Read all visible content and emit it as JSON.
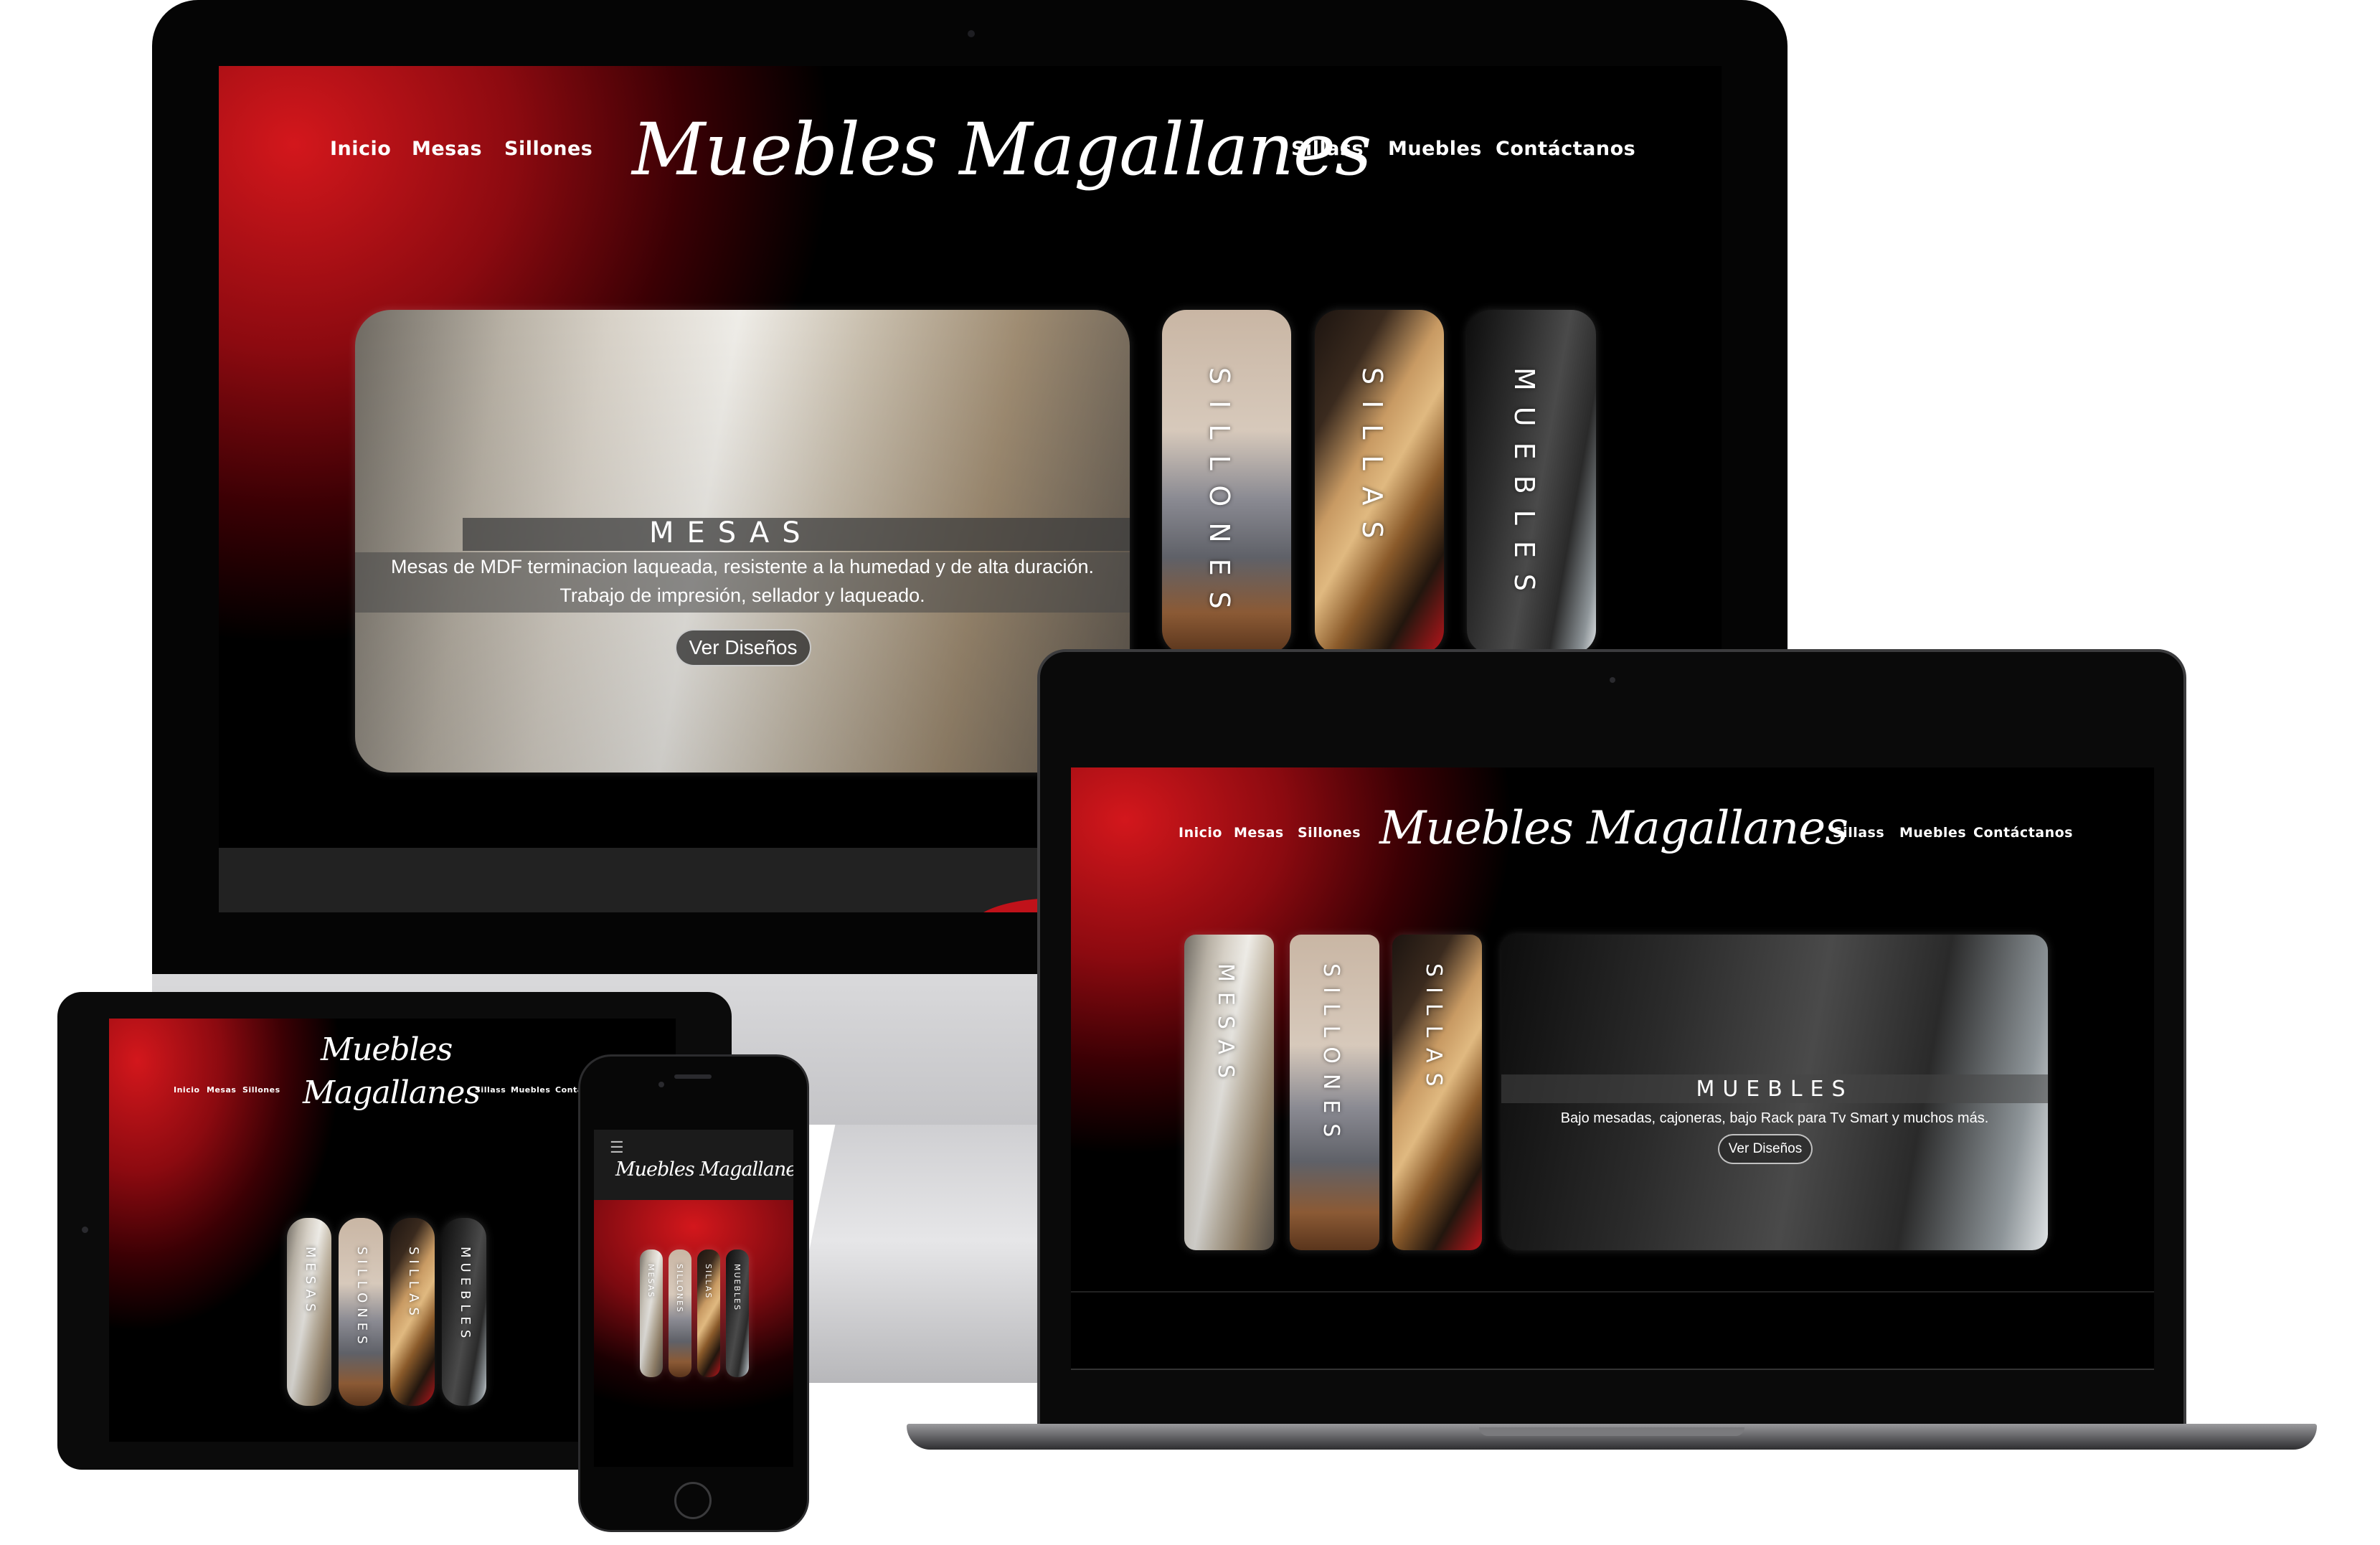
{
  "site": {
    "logo": "Muebles Magallanes",
    "logo_line1": "Muebles",
    "logo_line2": "Magallanes",
    "nav_left": [
      "Inicio",
      "Mesas",
      "Sillones"
    ],
    "nav_right": [
      "Sillass",
      "Muebles",
      "Contáctanos"
    ],
    "nav_right_cut": "Contá"
  },
  "desktop": {
    "featured": {
      "title": "MESAS",
      "desc_line1": "Mesas de MDF terminacion laqueada, resistente a la humedad y de alta duración.",
      "desc_line2": "Trabajo de impresión, sellador y laqueado.",
      "button": "Ver Diseños"
    },
    "side_cards": [
      "SILLONES",
      "SILLAS",
      "MUEBLES"
    ]
  },
  "laptop": {
    "side_cards": [
      "MESAS",
      "SILLONES",
      "SILLAS"
    ],
    "featured": {
      "title": "MUEBLES",
      "desc": "Bajo mesadas, cajoneras, bajo Rack para Tv Smart y muchos más.",
      "button": "Ver Diseños"
    }
  },
  "tablet": {
    "cards": [
      "MESAS",
      "SILLONES",
      "SILLAS",
      "MUEBLES"
    ]
  },
  "phone": {
    "menu_icon": "hamburger-icon",
    "cards": [
      "MESAS",
      "SILLONES",
      "SILLAS",
      "MUEBLES"
    ]
  },
  "colors": {
    "accent_red": "#d3171c",
    "background": "#000000",
    "white": "#ffffff"
  }
}
